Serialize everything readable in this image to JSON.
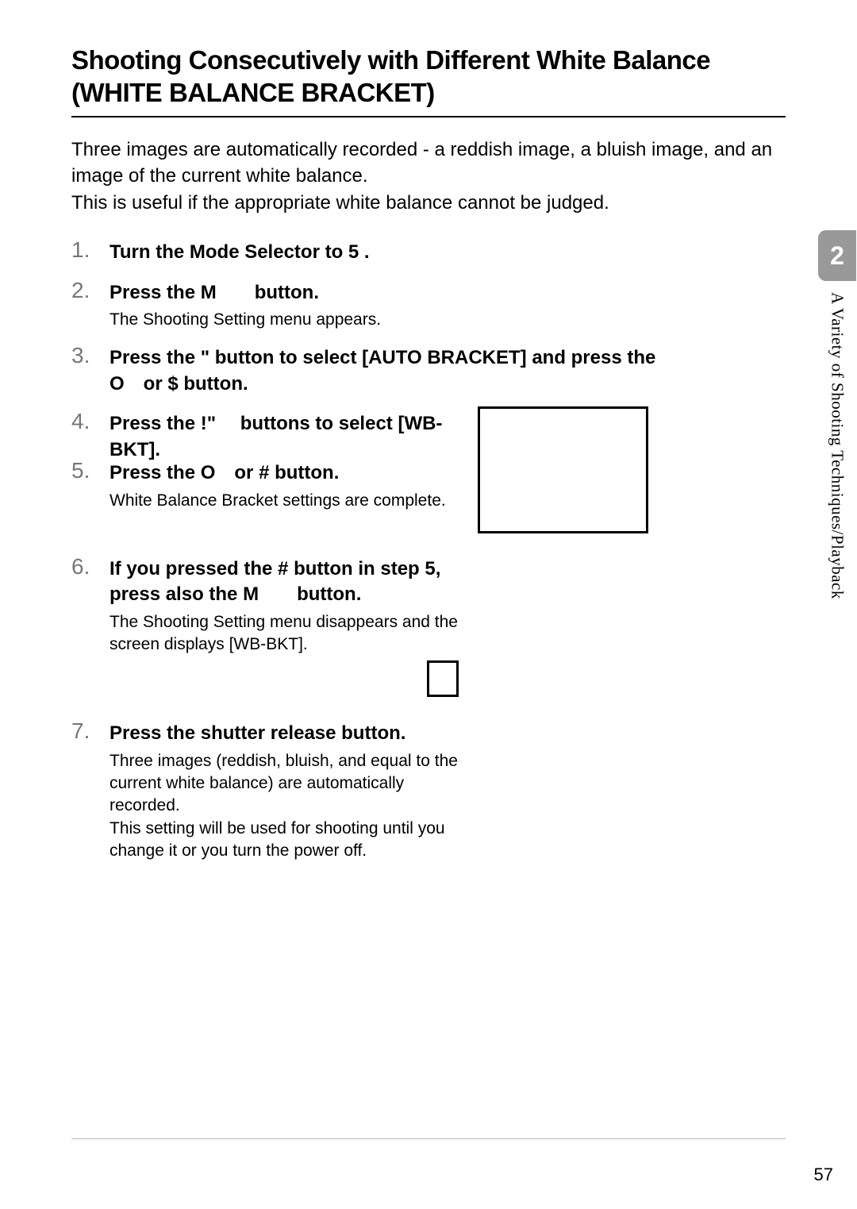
{
  "title": "Shooting Consecutively with Different White Balance (WHITE BALANCE BRACKET)",
  "intro": "Three images are automatically recorded - a reddish image, a bluish image, and an image of the current white balance.\nThis is useful if the appropriate white balance cannot be judged.",
  "steps": [
    {
      "title": "Turn the Mode Selector to 5 .",
      "body": ""
    },
    {
      "title": "Press the M  button.",
      "body": "The Shooting Setting menu appears."
    },
    {
      "title": "Press the \"  button to select [AUTO BRACKET] and press the O or $  button.",
      "body": ""
    },
    {
      "title": "Press the !\"  buttons to select [WB-BKT].",
      "body": ""
    },
    {
      "title": "Press the O or #  button.",
      "body": "White Balance Bracket settings are complete."
    },
    {
      "title": "If you pressed the #  button in step 5, press also the M  button.",
      "body": "The Shooting Setting menu disappears and the screen displays [WB-BKT]."
    },
    {
      "title": "Press the shutter release button.",
      "body": "Three images (reddish, bluish, and equal to the current white balance) are automatically recorded.\nThis setting will be used for shooting until you change it or you turn the power off."
    }
  ],
  "chapter": {
    "number": "2",
    "label": "A Variety of Shooting Techniques/Playback"
  },
  "page_number": "57"
}
